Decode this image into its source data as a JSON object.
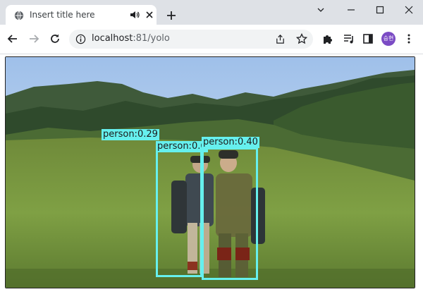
{
  "tab": {
    "title": "Insert title here"
  },
  "omnibox": {
    "host": "localhost",
    "rest": ":81/yolo"
  },
  "profile": {
    "initials": "승현"
  },
  "detections": [
    {
      "label": "person:0.29"
    },
    {
      "label": "person:0.6"
    },
    {
      "label": "person:0.40"
    }
  ],
  "colors": {
    "bbox": "#66f0ee",
    "tabstrip": "#dee1e6",
    "avatar": "#7b4bc4"
  },
  "icons": [
    "globe-icon",
    "audio-icon",
    "close-icon",
    "plus-icon",
    "chevron-down-icon",
    "minimize-icon",
    "maximize-icon",
    "window-close-icon",
    "back-arrow-icon",
    "forward-arrow-icon",
    "reload-icon",
    "info-icon",
    "share-icon",
    "star-icon",
    "puzzle-icon",
    "media-icon",
    "sidepanel-icon",
    "kebab-menu-icon"
  ]
}
